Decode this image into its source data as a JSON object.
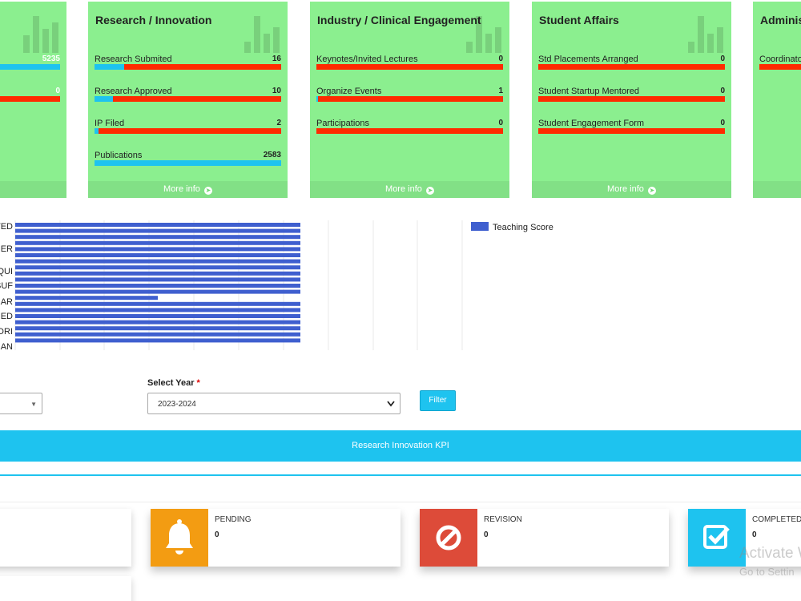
{
  "cards": [
    {
      "id": "partial-left",
      "title": "",
      "metrics": [
        {
          "label": "",
          "value": "5235",
          "fraction": 1.0
        },
        {
          "label": "",
          "value": "0",
          "fraction": 0.0
        }
      ],
      "footer": ""
    },
    {
      "id": "research-innovation",
      "title": "Research / Innovation",
      "metrics": [
        {
          "label": "Research Submited",
          "value": "16",
          "fraction": 0.16
        },
        {
          "label": "Research Approved",
          "value": "10",
          "fraction": 0.1
        },
        {
          "label": "IP Filed",
          "value": "2",
          "fraction": 0.02
        },
        {
          "label": "Publications",
          "value": "2583",
          "fraction": 1.0
        }
      ],
      "footer": "More info"
    },
    {
      "id": "industry-clinical",
      "title": "Industry / Clinical Engagement",
      "metrics": [
        {
          "label": "Keynotes/Invited Lectures",
          "value": "0",
          "fraction": 0.0
        },
        {
          "label": "Organize Events",
          "value": "1",
          "fraction": 0.01
        },
        {
          "label": "Participations",
          "value": "0",
          "fraction": 0.0
        }
      ],
      "footer": "More info"
    },
    {
      "id": "student-affairs",
      "title": "Student Affairs",
      "metrics": [
        {
          "label": "Std Placements Arranged",
          "value": "0",
          "fraction": 0.0
        },
        {
          "label": "Student Startup Mentored",
          "value": "0",
          "fraction": 0.0
        },
        {
          "label": "Student Engagement Form",
          "value": "0",
          "fraction": 0.0
        }
      ],
      "footer": "More info"
    },
    {
      "id": "administration",
      "title": "Adminis",
      "metrics": [
        {
          "label": "Coordinato",
          "value": "",
          "fraction": 0.0
        }
      ],
      "footer": ""
    }
  ],
  "chart_data": {
    "type": "bar",
    "orientation": "horizontal",
    "categories": [
      "TED",
      "ER",
      "QUI",
      "SUF",
      "AR",
      "IED",
      "DRI",
      "IAN"
    ],
    "series": [
      {
        "name": "Teaching Score",
        "color": "#3f5fcf",
        "values": [
          100,
          100,
          100,
          100,
          100,
          100,
          100,
          100,
          100,
          100,
          100,
          100,
          50,
          100,
          100,
          100,
          100,
          100,
          100,
          100
        ]
      }
    ],
    "legend_position": "top-right",
    "grid": true
  },
  "filter": {
    "left_select_value": "",
    "year_label": "Select Year",
    "year_required_mark": "*",
    "year_value": "2023-2024",
    "filter_button": "Filter"
  },
  "kpi_banner": "Research Innovation KPI",
  "status_boxes": [
    {
      "label": "PENDING",
      "value": "0",
      "color": "#f39c12",
      "icon": "bell-icon"
    },
    {
      "label": "REVISION",
      "value": "0",
      "color": "#dd4b39",
      "icon": "ban-icon"
    },
    {
      "label": "COMPLETED",
      "value": "0",
      "color": "#1ec3ef",
      "icon": "check-square-icon"
    }
  ],
  "watermark": {
    "line1": "Activate W",
    "line2": "Go to Settin"
  }
}
